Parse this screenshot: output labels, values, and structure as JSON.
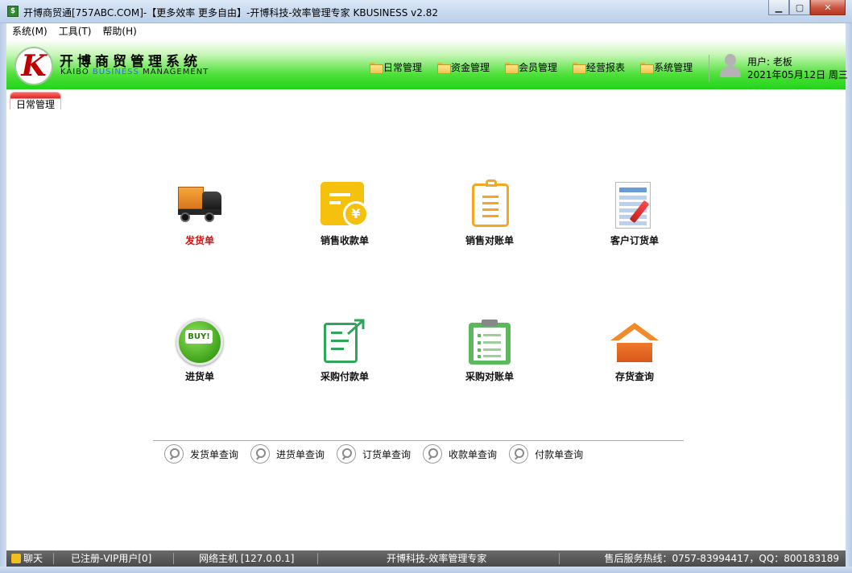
{
  "window": {
    "title": "开博商贸通[757ABC.COM]-【更多效率 更多自由】-开博科技-效率管理专家  KBUSINESS v2.82",
    "app_icon": "$"
  },
  "menubar": [
    "系统(M)",
    "工具(T)",
    "帮助(H)"
  ],
  "header": {
    "logo_letter": "K",
    "logo_cn": "开博商贸管理系统",
    "logo_en_a": "KAIBO ",
    "logo_en_b": "BUSINESS",
    "logo_en_c": " MANAGEMENT",
    "nav": [
      "日常管理",
      "资金管理",
      "会员管理",
      "经营报表",
      "系统管理"
    ],
    "user": "用户: 老板",
    "date": "2021年05月12日 周三"
  },
  "tab": "日常管理",
  "tiles": [
    {
      "label": "发货单",
      "icon": "truck-icon",
      "highlight": true
    },
    {
      "label": "销售收款单",
      "icon": "yen-receipt-icon"
    },
    {
      "label": "销售对账单",
      "icon": "clipboard-icon"
    },
    {
      "label": "客户订货单",
      "icon": "spreadsheet-pencil-icon"
    },
    {
      "label": "进货单",
      "icon": "buy-badge-icon",
      "badge": "BUY!"
    },
    {
      "label": "采购付款单",
      "icon": "edit-arrow-icon"
    },
    {
      "label": "采购对账单",
      "icon": "checklist-icon"
    },
    {
      "label": "存货查询",
      "icon": "house-icon"
    }
  ],
  "queries": [
    "发货单查询",
    "进货单查询",
    "订货单查询",
    "收款单查询",
    "付款单查询"
  ],
  "status": {
    "chat": "聊天",
    "register": "已注册-VIP用户[0]",
    "host": "网络主机 [127.0.0.1]",
    "company": "开博科技-效率管理专家",
    "hotline": "售后服务热线：0757-83994417，QQ：800183189"
  },
  "colors": {
    "accent_green": "#20d41a",
    "highlight_red": "#e01010"
  }
}
